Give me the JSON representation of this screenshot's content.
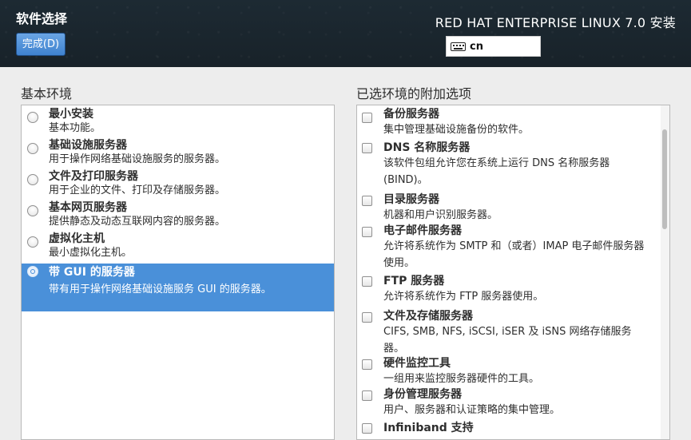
{
  "header": {
    "title": "软件选择",
    "done_label": "完成(D)",
    "product": "RED HAT ENTERPRISE LINUX 7.0 安装",
    "keyboard_layout": "cn"
  },
  "base_environment": {
    "label": "基本环境",
    "items": [
      {
        "title": "最小安装",
        "desc": "基本功能。",
        "selected": false
      },
      {
        "title": "基础设施服务器",
        "desc": "用于操作网络基础设施服务的服务器。",
        "selected": false
      },
      {
        "title": "文件及打印服务器",
        "desc": "用于企业的文件、打印及存储服务器。",
        "selected": false
      },
      {
        "title": "基本网页服务器",
        "desc": "提供静态及动态互联网内容的服务器。",
        "selected": false
      },
      {
        "title": "虚拟化主机",
        "desc": "最小虚拟化主机。",
        "selected": false
      },
      {
        "title": "带 GUI 的服务器",
        "desc": "带有用于操作网络基础设施服务 GUI 的服务器。",
        "selected": true
      }
    ]
  },
  "addons": {
    "label": "已选环境的附加选项",
    "items": [
      {
        "title": "备份服务器",
        "desc": "集中管理基础设施备份的软件。"
      },
      {
        "title": "DNS 名称服务器",
        "desc": "该软件包组允许您在系统上运行 DNS 名称服务器 (BIND)。"
      },
      {
        "title": "目录服务器",
        "desc": "机器和用户识别服务器。"
      },
      {
        "title": "电子邮件服务器",
        "desc": "允许将系统作为 SMTP 和（或者）IMAP 电子邮件服务器使用。"
      },
      {
        "title": "FTP 服务器",
        "desc": "允许将系统作为 FTP 服务器使用。"
      },
      {
        "title": "文件及存储服务器",
        "desc": "CIFS, SMB, NFS, iSCSI, iSER 及 iSNS 网络存储服务器。"
      },
      {
        "title": "硬件监控工具",
        "desc": "一组用来监控服务器硬件的工具。"
      },
      {
        "title": "身份管理服务器",
        "desc": "用户、服务器和认证策略的集中管理。"
      },
      {
        "title": "Infiniband 支持",
        "desc": ""
      }
    ]
  }
}
